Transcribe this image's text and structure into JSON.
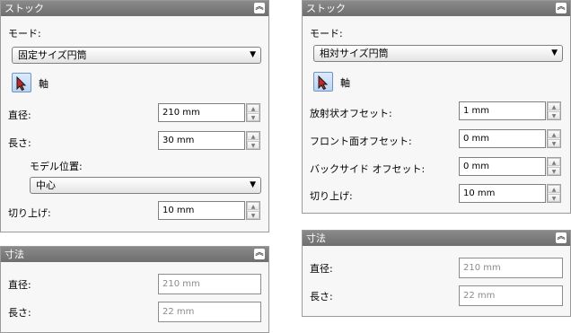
{
  "left": {
    "stock": {
      "title": "ストック",
      "mode_label": "モード:",
      "mode_value": "固定サイズ円筒",
      "axis_label": "軸",
      "diameter_label": "直径:",
      "diameter_value": "210 mm",
      "length_label": "長さ:",
      "length_value": "30 mm",
      "model_position_label": "モデル位置:",
      "model_position_value": "中心",
      "roundup_label": "切り上げ:",
      "roundup_value": "10 mm"
    },
    "dims": {
      "title": "寸法",
      "diameter_label": "直径:",
      "diameter_value": "210 mm",
      "length_label": "長さ:",
      "length_value": "22 mm"
    }
  },
  "right": {
    "stock": {
      "title": "ストック",
      "mode_label": "モード:",
      "mode_value": "相対サイズ円筒",
      "axis_label": "軸",
      "radial_offset_label": "放射状オフセット:",
      "radial_offset_value": "1 mm",
      "front_offset_label": "フロント面オフセット:",
      "front_offset_value": "0 mm",
      "back_offset_label": "バックサイド オフセット:",
      "back_offset_value": "0 mm",
      "roundup_label": "切り上げ:",
      "roundup_value": "10 mm"
    },
    "dims": {
      "title": "寸法",
      "diameter_label": "直径:",
      "diameter_value": "210 mm",
      "length_label": "長さ:",
      "length_value": "22 mm"
    }
  },
  "icons": {
    "collapse": "double-chevron-up-icon",
    "axis_tool": "cursor-arrow-icon",
    "spin_up": "triangle-up-icon",
    "spin_down": "triangle-down-icon",
    "dropdown": "triangle-down-icon"
  },
  "colors": {
    "header_bg": "#7a7a7a",
    "panel_bg": "#f7f7f7",
    "tool_button": "#c6dcf5",
    "arrow_icon": "#c0282d"
  }
}
